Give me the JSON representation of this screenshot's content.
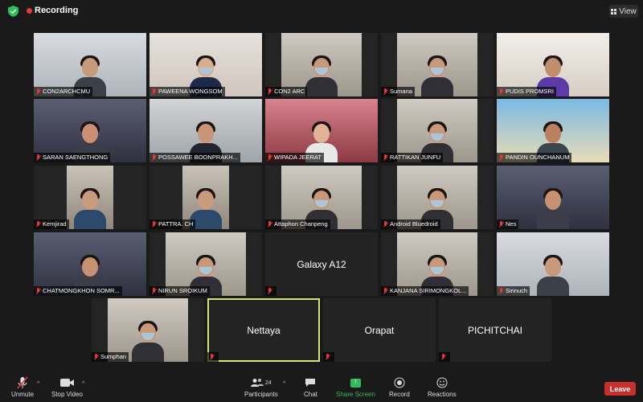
{
  "top": {
    "recording_label": "Recording",
    "view_label": "View"
  },
  "toolbar": {
    "unmute": "Unmute",
    "stop_video": "Stop Video",
    "participants": "Participants",
    "participants_count": "24",
    "chat": "Chat",
    "share_screen": "Share Screen",
    "record": "Record",
    "reactions": "Reactions",
    "leave": "Leave"
  },
  "colors": {
    "share": "#2ebd5a",
    "leave": "#c9302c",
    "recording": "#e53935",
    "active_speaker": "#d8e37a"
  },
  "participants": [
    {
      "name": "CON2ARCHCMU",
      "scene": "room"
    },
    {
      "name": "PAWEENA WONGSOM",
      "scene": "two"
    },
    {
      "name": "CON2 ARC",
      "scene": "mask"
    },
    {
      "name": "Sumana",
      "scene": "mask"
    },
    {
      "name": "PUDIS PROMSRI",
      "scene": "purple"
    },
    {
      "name": "SARAN SAENGTHONG",
      "scene": "close"
    },
    {
      "name": "POSSAWEE BOONPRAKH...",
      "scene": "office"
    },
    {
      "name": "WIPADA JEERAT",
      "scene": "blossom"
    },
    {
      "name": "RATTIKAN JUNFU",
      "scene": "mask"
    },
    {
      "name": "PANDIN OUNCHANUM",
      "scene": "beach"
    },
    {
      "name": "Kemjirad",
      "scene": "plain"
    },
    {
      "name": "PATTRA. CH",
      "scene": "plain"
    },
    {
      "name": "Attaphon Chanpeng",
      "scene": "mask"
    },
    {
      "name": "Android Bluedroid",
      "scene": "mask"
    },
    {
      "name": "Nes",
      "scene": "close"
    },
    {
      "name": "CHATMONGKHON SOMR...",
      "scene": "close"
    },
    {
      "name": "NIRUN SROIKUM",
      "scene": "mask"
    },
    {
      "name": "",
      "label": "Galaxy A12",
      "scene": "empty"
    },
    {
      "name": "KANJANA SIRIMONGKOL...",
      "scene": "mask"
    },
    {
      "name": "Sirinuch",
      "scene": "room"
    },
    {
      "name": "Sumphan",
      "scene": "mask"
    },
    {
      "name": "",
      "label": "Nettaya",
      "scene": "empty",
      "active": true
    },
    {
      "name": "",
      "label": "Orapat",
      "scene": "empty"
    },
    {
      "name": "",
      "label": "PICHITCHAI",
      "scene": "empty"
    }
  ]
}
